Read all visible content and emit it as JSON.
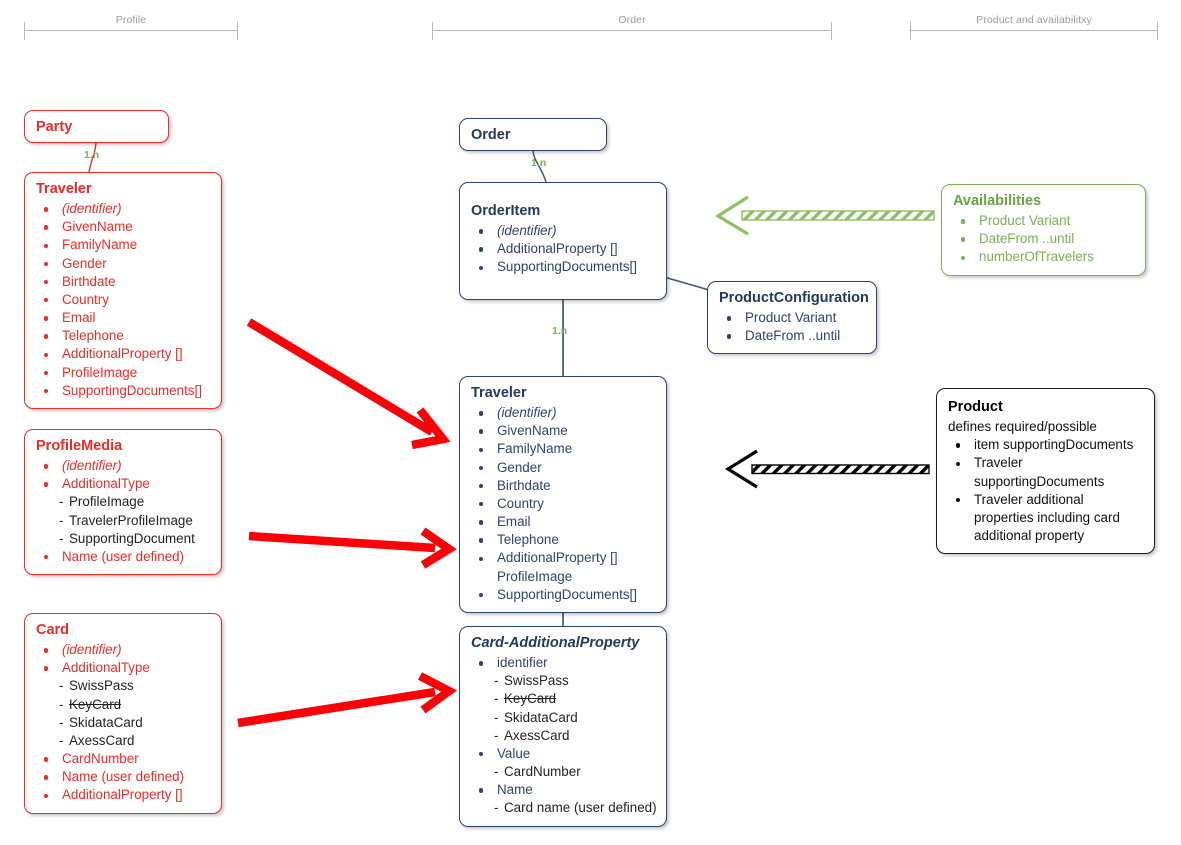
{
  "groups": [
    {
      "label": "Profile"
    },
    {
      "label": "Order"
    },
    {
      "label": "Product and availabilitxy"
    }
  ],
  "colors": {
    "profile_red": "#ee2b27",
    "order_blue": "#2e4372",
    "availability_green": "#77b255",
    "product_black": "#111111",
    "cardinality_green": "#77b255",
    "arrow_red": "#fb0007",
    "arrow_black": "#000000",
    "group_grey": "#9b9b9b"
  },
  "boxes": {
    "party": {
      "title": "Party",
      "items": []
    },
    "traveler_profile": {
      "title": "Traveler",
      "items": [
        {
          "text": "(identifier)",
          "style": "bullet ital"
        },
        {
          "text": "GivenName",
          "style": "bullet"
        },
        {
          "text": "FamilyName",
          "style": "bullet"
        },
        {
          "text": "Gender",
          "style": "bullet"
        },
        {
          "text": "Birthdate",
          "style": "bullet"
        },
        {
          "text": "Country",
          "style": "bullet"
        },
        {
          "text": "Email",
          "style": "bullet"
        },
        {
          "text": "Telephone",
          "style": "bullet"
        },
        {
          "text": "AdditionalProperty []",
          "style": "bullet"
        },
        {
          "text": "ProfileImage",
          "style": "bullet"
        },
        {
          "text": "SupportingDocuments[]",
          "style": "bullet"
        }
      ]
    },
    "profile_media": {
      "title": "ProfileMedia",
      "items": [
        {
          "text": "(identifier)",
          "style": "bullet ital"
        },
        {
          "text": "AdditionalType",
          "style": "bullet"
        },
        {
          "text": "ProfileImage",
          "style": "dash"
        },
        {
          "text": "TravelerProfileImage",
          "style": "dash"
        },
        {
          "text": "SupportingDocument",
          "style": "dash"
        },
        {
          "text": "Name (user defined)",
          "style": "bullet"
        }
      ]
    },
    "card": {
      "title": "Card",
      "items": [
        {
          "text": "(identifier)",
          "style": "bullet ital"
        },
        {
          "text": "AdditionalType",
          "style": "bullet"
        },
        {
          "text": "SwissPass",
          "style": "dash"
        },
        {
          "text": "KeyCard",
          "style": "dash strike"
        },
        {
          "text": "SkidataCard",
          "style": "dash"
        },
        {
          "text": "AxessCard",
          "style": "dash"
        },
        {
          "text": "CardNumber",
          "style": "bullet"
        },
        {
          "text": "Name (user defined)",
          "style": "bullet"
        },
        {
          "text": "AdditionalProperty []",
          "style": "bullet"
        }
      ]
    },
    "order": {
      "title": "Order",
      "items": []
    },
    "order_item": {
      "title": "OrderItem",
      "items": [
        {
          "text": "(identifier)",
          "style": "bullet ital"
        },
        {
          "text": "AdditionalProperty []",
          "style": "bullet"
        },
        {
          "text": "SupportingDocuments[]",
          "style": "bullet"
        }
      ]
    },
    "traveler_order": {
      "title": "Traveler",
      "items": [
        {
          "text": "(identifier)",
          "style": "bullet ital"
        },
        {
          "text": "GivenName",
          "style": "bullet"
        },
        {
          "text": "FamilyName",
          "style": "bullet"
        },
        {
          "text": "Gender",
          "style": "bullet"
        },
        {
          "text": "Birthdate",
          "style": "bullet"
        },
        {
          "text": "Country",
          "style": "bullet"
        },
        {
          "text": "Email",
          "style": "bullet"
        },
        {
          "text": "Telephone",
          "style": "bullet"
        },
        {
          "text": "AdditionalProperty []",
          "style": "bullet"
        },
        {
          "text": "ProfileImage",
          "style": "nob"
        },
        {
          "text": "SupportingDocuments[]",
          "style": "bullet"
        }
      ]
    },
    "card_additional_property": {
      "title": "Card-AdditionalProperty",
      "items": [
        {
          "text": "identifier",
          "style": "bullet"
        },
        {
          "text": "SwissPass",
          "style": "dash"
        },
        {
          "text": "KeyCard",
          "style": "dash strike"
        },
        {
          "text": "SkidataCard",
          "style": "dash"
        },
        {
          "text": "AxessCard",
          "style": "dash"
        },
        {
          "text": "Value",
          "style": "bullet"
        },
        {
          "text": "CardNumber",
          "style": "dash"
        },
        {
          "text": "Name",
          "style": "bullet"
        },
        {
          "text": "Card name (user defined)",
          "style": "dash"
        }
      ]
    },
    "product_configuration": {
      "title": "ProductConfiguration",
      "items": [
        {
          "text": "Product Variant",
          "style": "bullet"
        },
        {
          "text": "DateFrom ..until",
          "style": "bullet"
        }
      ]
    },
    "availabilities": {
      "title": "Availabilities",
      "items": [
        {
          "text": "Product Variant",
          "style": "bullet"
        },
        {
          "text": "DateFrom ..until",
          "style": "bullet"
        },
        {
          "text": "numberOfTravelers",
          "style": "bullet"
        }
      ]
    },
    "product": {
      "title": "Product",
      "subtitle": "defines required/possible",
      "items": [
        {
          "text": "item supportingDocuments",
          "style": "bullet"
        },
        {
          "text": "Traveler supportingDocuments",
          "style": "bullet wrap"
        },
        {
          "text": "Traveler additional properties including card additional property",
          "style": "bullet wrap"
        }
      ]
    }
  },
  "connectors": [
    {
      "from": "party",
      "to": "traveler_profile",
      "label": "1.n"
    },
    {
      "from": "order",
      "to": "order_item",
      "label": "1.n"
    },
    {
      "from": "order_item",
      "to": "traveler_order",
      "label": "1.n"
    },
    {
      "from": "order_item",
      "to": "product_configuration",
      "label": ""
    },
    {
      "from": "traveler_order",
      "to": "card_additional_property",
      "label": ""
    }
  ],
  "annotation_arrows": [
    {
      "name": "profile-traveler-to-order-traveler",
      "color": "#fb0007"
    },
    {
      "name": "profile-media-to-order-traveler",
      "color": "#fb0007"
    },
    {
      "name": "card-to-card-additional-property",
      "color": "#fb0007"
    },
    {
      "name": "availabilities-to-product-configuration",
      "color": "#7db04f"
    },
    {
      "name": "product-to-order-traveler",
      "color": "#000000"
    }
  ]
}
